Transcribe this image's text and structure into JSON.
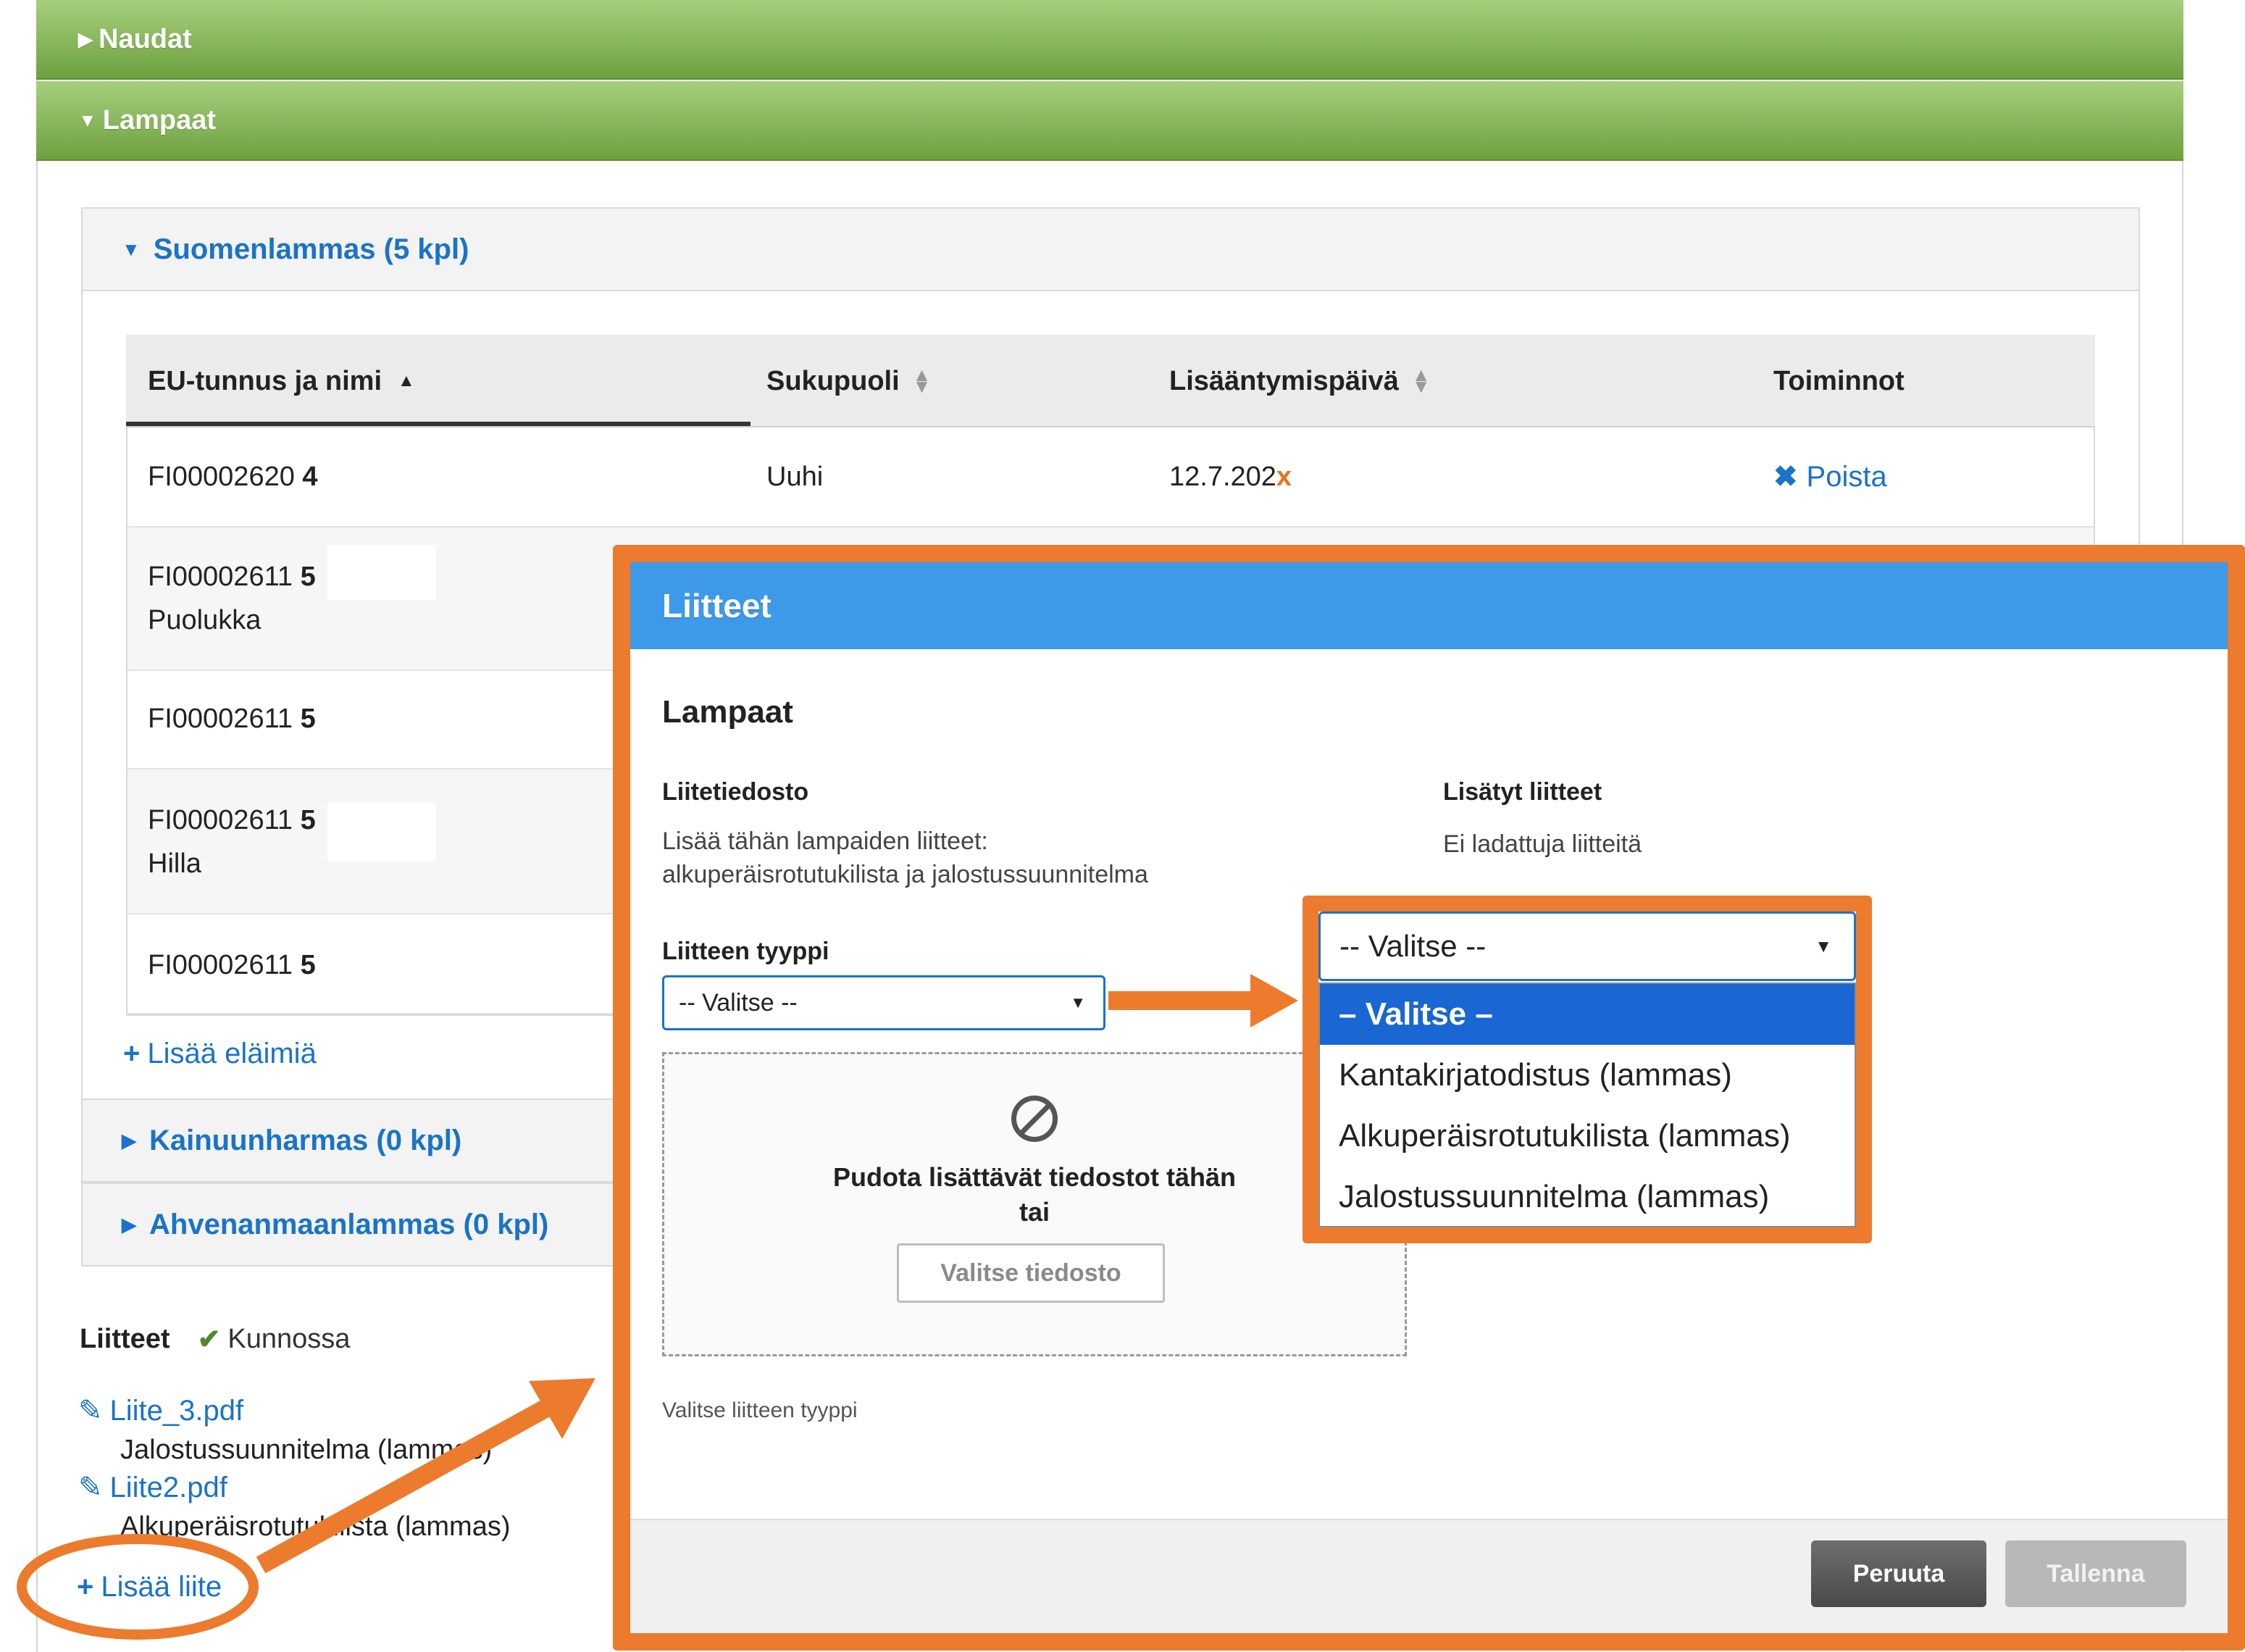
{
  "accordion": {
    "cattle": {
      "label": "Naudat"
    },
    "sheep": {
      "label": "Lampaat"
    }
  },
  "breeds": {
    "suomenlammas": {
      "label": "Suomenlammas (5 kpl)"
    },
    "kainuunharmas": {
      "label": "Kainuunharmas (0 kpl)"
    },
    "ahvenanmaanlammas": {
      "label": "Ahvenanmaanlammas (0 kpl)"
    }
  },
  "table": {
    "headers": [
      "EU-tunnus ja nimi",
      "Sukupuoli",
      "Lisääntymispäivä",
      "Toiminnot"
    ],
    "rows": [
      {
        "id": "FI00002620",
        "suffix": "4",
        "name": "",
        "sex": "Uuhi",
        "date": "12.7.202",
        "date_mark": "x",
        "action": "Poista"
      },
      {
        "id": "FI00002611",
        "suffix": "5",
        "name": "Puolukka"
      },
      {
        "id": "FI00002611",
        "suffix": "5",
        "name": ""
      },
      {
        "id": "FI00002611",
        "suffix": "5",
        "name": "Hilla"
      },
      {
        "id": "FI00002611",
        "suffix": "5",
        "name": ""
      }
    ]
  },
  "add_animals": {
    "label": "Lisää eläimiä"
  },
  "attachments": {
    "title": "Liitteet",
    "status": "Kunnossa",
    "files": [
      {
        "name": "Liite_3.pdf",
        "type": "Jalostussuunnitelma (lammas)"
      },
      {
        "name": "Liite2.pdf",
        "type": "Alkuperäisrotutukilista (lammas)"
      }
    ],
    "add_label": "Lisää liite"
  },
  "modal": {
    "title": "Liitteet",
    "section_title": "Lampaat",
    "file_label": "Liitetiedosto",
    "file_help_1": "Lisää tähän lampaiden liitteet:",
    "file_help_2": "alkuperäisrotutukilista ja jalostussuunnitelma",
    "added_label": "Lisätyt liitteet",
    "no_files": "Ei ladattuja liitteitä",
    "type_label": "Liitteen tyyppi",
    "type_value": "-- Valitse --",
    "drop_text_1": "Pudota lisättävät tiedostot tähän",
    "drop_text_2": "tai",
    "choose_file": "Valitse tiedosto",
    "type_hint": "Valitse liitteen tyyppi",
    "cancel": "Peruuta",
    "save": "Tallenna"
  },
  "dropdown": {
    "value": "-- Valitse --",
    "options": [
      "– Valitse –",
      "Kantakirjatodistus (lammas)",
      "Alkuperäisrotutukilista (lammas)",
      "Jalostussuunnitelma (lammas)"
    ],
    "selected_index": 0
  },
  "colors": {
    "accent_orange": "#ec7b2d",
    "link_blue": "#1a73c8",
    "header_green": "#7aab4b",
    "modal_header_blue": "#3d9ae8"
  }
}
